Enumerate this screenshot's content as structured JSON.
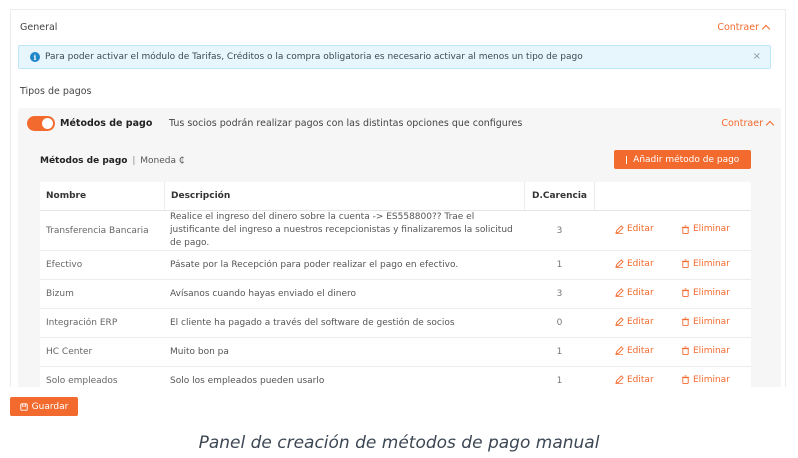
{
  "general": {
    "title": "General",
    "collapse_label": "Contraer"
  },
  "info_banner": {
    "text": "Para poder activar el módulo de Tarifas, Créditos o la compra obligatoria es necesario activar al menos un tipo de pago",
    "close": "×"
  },
  "payment_types": {
    "title": "Tipos de pagos",
    "toggle_on": true,
    "label": "Métodos de pago",
    "description": "Tus socios podrán realizar pagos con las distintas opciones que configures",
    "collapse_label": "Contraer"
  },
  "methods": {
    "title": "Métodos de pago",
    "separator": "|",
    "currency_label": "Moneda ₵",
    "add_button": "Añadir método de pago",
    "columns": [
      "Nombre",
      "Descripción",
      "D.Carencia"
    ],
    "edit_label": "Editar",
    "delete_label": "Eliminar",
    "rows": [
      {
        "name": "Transferencia Bancaria",
        "description": "Realice el ingreso del dinero sobre la cuenta -> ES558800?? Trae el justificante del ingreso a nuestros recepcionistas y finalizaremos la solicitud de pago.",
        "days": "3"
      },
      {
        "name": "Efectivo",
        "description": "Pásate por la Recepción para poder realizar el pago en efectivo.",
        "days": "1"
      },
      {
        "name": "Bizum",
        "description": "Avísanos cuando hayas enviado el dinero",
        "days": "3"
      },
      {
        "name": "Integración ERP",
        "description": "El cliente ha pagado a través del software de gestión de socios",
        "days": "0"
      },
      {
        "name": "HC Center",
        "description": "Muito bon pa",
        "days": "1"
      },
      {
        "name": "Solo empleados",
        "description": "Solo los empleados pueden usarlo",
        "days": "1"
      }
    ]
  },
  "save_button": "Guardar",
  "caption": "Panel de creación de métodos de pago manual",
  "colors": {
    "accent": "#f26a2e",
    "info_bg": "#e7f6fd",
    "info_icon": "#1f86c8"
  }
}
